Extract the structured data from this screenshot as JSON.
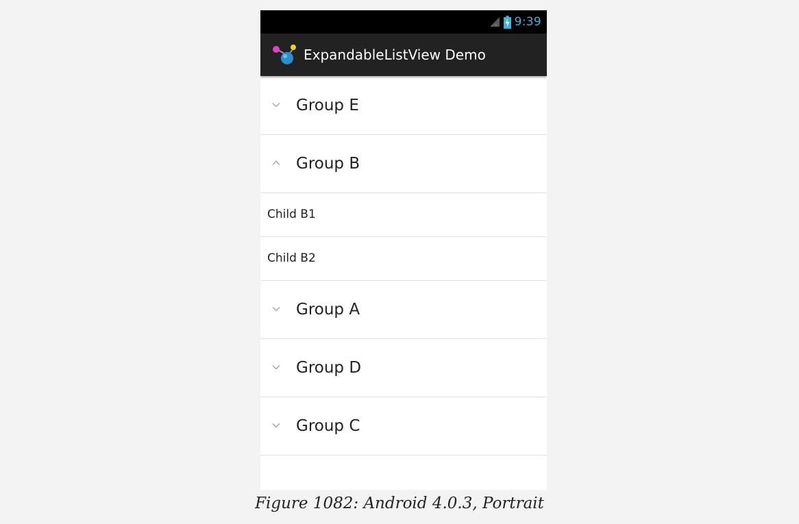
{
  "status_bar": {
    "time": "9:39",
    "icons": [
      "signal-icon",
      "battery-charging-icon"
    ],
    "time_color": "#33b5e5"
  },
  "action_bar": {
    "app_icon": "app-logo-icon",
    "title": "ExpandableListView Demo"
  },
  "list": {
    "group_e": {
      "label": "Group E",
      "state": "collapsed",
      "icon": "chevron-down-icon"
    },
    "group_b": {
      "label": "Group B",
      "state": "expanded",
      "icon": "chevron-up-icon"
    },
    "child_b1": {
      "label": "Child B1"
    },
    "child_b2": {
      "label": "Child B2"
    },
    "group_a": {
      "label": "Group A",
      "state": "collapsed",
      "icon": "chevron-down-icon"
    },
    "group_d": {
      "label": "Group D",
      "state": "collapsed",
      "icon": "chevron-down-icon"
    },
    "group_c": {
      "label": "Group C",
      "state": "collapsed",
      "icon": "chevron-down-icon"
    }
  },
  "caption": "Figure 1082: Android 4.0.3, Portrait"
}
